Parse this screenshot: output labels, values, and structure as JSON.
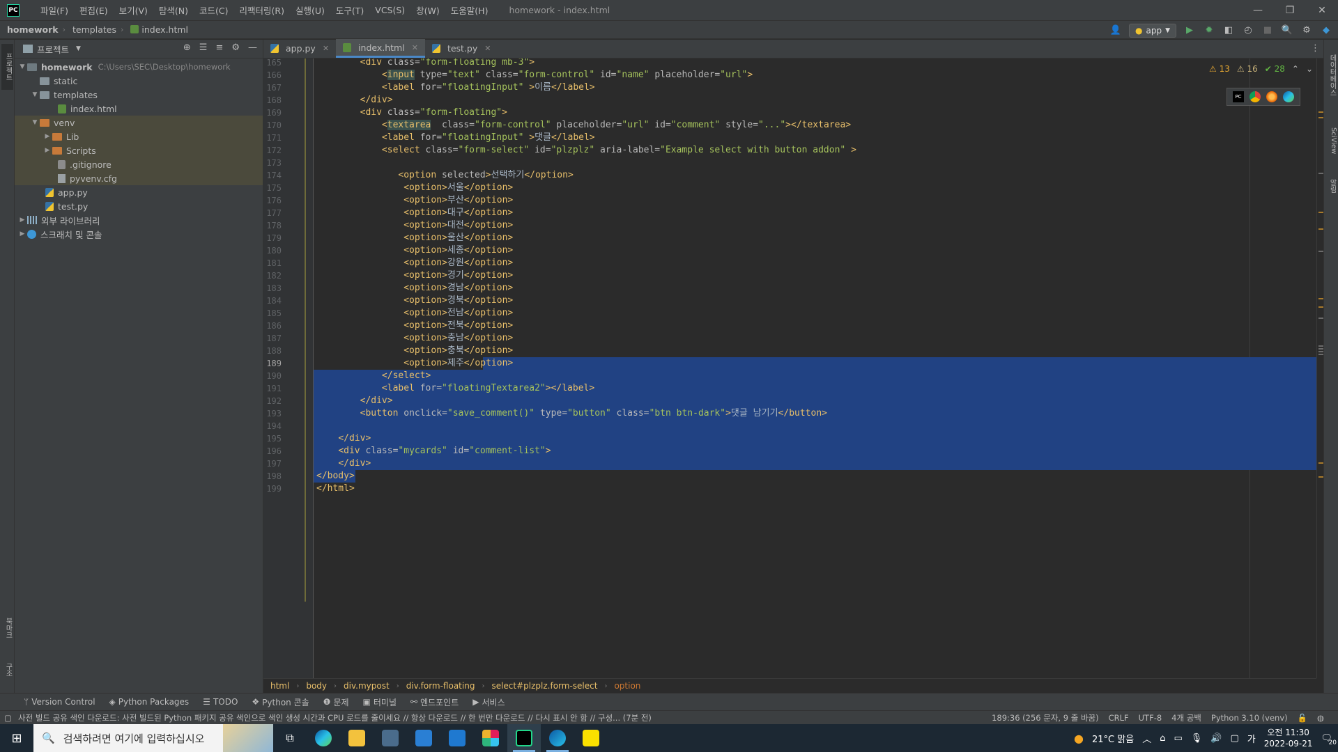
{
  "titlebar": {
    "menus": [
      "파일(F)",
      "편집(E)",
      "보기(V)",
      "탐색(N)",
      "코드(C)",
      "리팩터링(R)",
      "실행(U)",
      "도구(T)",
      "VCS(S)",
      "창(W)",
      "도움말(H)"
    ],
    "window_title": "homework - index.html",
    "logo": "PC"
  },
  "navbar": {
    "crumbs": [
      "homework",
      "templates",
      "index.html"
    ],
    "run_config": "app"
  },
  "project": {
    "title": "프로젝트",
    "root_name": "homework",
    "root_path": "C:\\Users\\SEC\\Desktop\\homework",
    "items": {
      "static": "static",
      "templates": "templates",
      "index_html": "index.html",
      "venv": "venv",
      "lib": "Lib",
      "scripts": "Scripts",
      "gitignore": ".gitignore",
      "pyvenv": "pyvenv.cfg",
      "app_py": "app.py",
      "test_py": "test.py",
      "ext_libs": "외부 라이브러리",
      "scratches": "스크래치 및 콘솔"
    }
  },
  "tabs": [
    "app.py",
    "index.html",
    "test.py"
  ],
  "inspections": {
    "warnings": "13",
    "weak": "16",
    "ok": "28"
  },
  "editor": {
    "lines": [
      {
        "n": "165",
        "html": "        <span class='t-tag'>&lt;div </span><span class='t-attr'>class=</span><span class='t-val'>\"form-floating mb-3\"</span><span class='t-tag'>&gt;</span>"
      },
      {
        "n": "166",
        "html": "            <span class='t-tag'>&lt;<span class='t-hl'>input</span> </span><span class='t-attr'>type=</span><span class='t-val'>\"text\"</span> <span class='t-attr'>class=</span><span class='t-val'>\"form-control\"</span> <span class='t-attr'>id=</span><span class='t-val'>\"name\"</span> <span class='t-attr'>placeholder=</span><span class='t-val'>\"url\"</span><span class='t-tag'>&gt;</span>"
      },
      {
        "n": "167",
        "html": "            <span class='t-tag'>&lt;label </span><span class='t-attr'>for=</span><span class='t-val'>\"floatingInput\"</span> <span class='t-tag'>&gt;</span><span class='t-txt'>이름</span><span class='t-tag'>&lt;/label&gt;</span>"
      },
      {
        "n": "168",
        "html": "        <span class='t-tag'>&lt;/div&gt;</span>"
      },
      {
        "n": "169",
        "html": "        <span class='t-tag'>&lt;div </span><span class='t-attr'>class=</span><span class='t-val'>\"form-floating\"</span><span class='t-tag'>&gt;</span>"
      },
      {
        "n": "170",
        "html": "            <span class='t-tag'>&lt;<span class='t-hl'>textarea</span>  </span><span class='t-attr'>class=</span><span class='t-val'>\"form-control\"</span> <span class='t-attr'>placeholder=</span><span class='t-val'>\"url\"</span> <span class='t-attr'>id=</span><span class='t-val'>\"comment\"</span> <span class='t-attr'>style=</span><span class='t-val'>\"...\"</span><span class='t-tag'>&gt;&lt;/textarea&gt;</span>"
      },
      {
        "n": "171",
        "html": "            <span class='t-tag'>&lt;label </span><span class='t-attr'>for=</span><span class='t-val'>\"floatingInput\"</span> <span class='t-tag'>&gt;</span><span class='t-txt'>댓글</span><span class='t-tag'>&lt;/label&gt;</span>"
      },
      {
        "n": "172",
        "html": "            <span class='t-tag'>&lt;select </span><span class='t-attr'>class=</span><span class='t-val'>\"form-select\"</span> <span class='t-attr'>id=</span><span class='t-val'>\"plzplz\"</span> <span class='t-attr'>aria-label=</span><span class='t-val'>\"Example select with button addon\"</span> <span class='t-tag'>&gt;</span>"
      },
      {
        "n": "173",
        "html": ""
      },
      {
        "n": "174",
        "html": "               <span class='t-tag'>&lt;option </span><span class='t-attr'>selected</span><span class='t-tag'>&gt;</span><span class='t-txt'>선택하기</span><span class='t-tag'>&lt;/option&gt;</span>"
      },
      {
        "n": "175",
        "html": "                <span class='t-tag'>&lt;option&gt;</span><span class='t-txt'>서울</span><span class='t-tag'>&lt;/option&gt;</span>"
      },
      {
        "n": "176",
        "html": "                <span class='t-tag'>&lt;option&gt;</span><span class='t-txt'>부산</span><span class='t-tag'>&lt;/option&gt;</span>"
      },
      {
        "n": "177",
        "html": "                <span class='t-tag'>&lt;option&gt;</span><span class='t-txt'>대구</span><span class='t-tag'>&lt;/option&gt;</span>"
      },
      {
        "n": "178",
        "html": "                <span class='t-tag'>&lt;option&gt;</span><span class='t-txt'>대전</span><span class='t-tag'>&lt;/option&gt;</span>"
      },
      {
        "n": "179",
        "html": "                <span class='t-tag'>&lt;option&gt;</span><span class='t-txt'>울산</span><span class='t-tag'>&lt;/option&gt;</span>"
      },
      {
        "n": "180",
        "html": "                <span class='t-tag'>&lt;option&gt;</span><span class='t-txt'>세종</span><span class='t-tag'>&lt;/option&gt;</span>"
      },
      {
        "n": "181",
        "html": "                <span class='t-tag'>&lt;option&gt;</span><span class='t-txt'>강원</span><span class='t-tag'>&lt;/option&gt;</span>"
      },
      {
        "n": "182",
        "html": "                <span class='t-tag'>&lt;option&gt;</span><span class='t-txt'>경기</span><span class='t-tag'>&lt;/option&gt;</span>"
      },
      {
        "n": "183",
        "html": "                <span class='t-tag'>&lt;option&gt;</span><span class='t-txt'>경남</span><span class='t-tag'>&lt;/option&gt;</span>"
      },
      {
        "n": "184",
        "html": "                <span class='t-tag'>&lt;option&gt;</span><span class='t-txt'>경북</span><span class='t-tag'>&lt;/option&gt;</span>"
      },
      {
        "n": "185",
        "html": "                <span class='t-tag'>&lt;option&gt;</span><span class='t-txt'>전남</span><span class='t-tag'>&lt;/option&gt;</span>"
      },
      {
        "n": "186",
        "html": "                <span class='t-tag'>&lt;option&gt;</span><span class='t-txt'>전북</span><span class='t-tag'>&lt;/option&gt;</span>"
      },
      {
        "n": "187",
        "html": "                <span class='t-tag'>&lt;option&gt;</span><span class='t-txt'>충남</span><span class='t-tag'>&lt;/option&gt;</span>"
      },
      {
        "n": "188",
        "html": "                <span class='t-tag'>&lt;option&gt;</span><span class='t-txt'>충북</span><span class='t-tag'>&lt;/option&gt;</span>"
      },
      {
        "n": "189",
        "html": "                <span class='t-tag'>&lt;option&gt;</span><span class='t-txt'>제주</span><span class='t-tag'>&lt;/option&gt;</span>"
      },
      {
        "n": "190",
        "html": "            <span class='t-tag'>&lt;/select&gt;</span>"
      },
      {
        "n": "191",
        "html": "            <span class='t-tag'>&lt;label </span><span class='t-attr'>for=</span><span class='t-val'>\"floatingTextarea2\"</span><span class='t-tag'>&gt;&lt;/label&gt;</span>"
      },
      {
        "n": "192",
        "html": "        <span class='t-tag'>&lt;/div&gt;</span>"
      },
      {
        "n": "193",
        "html": "        <span class='t-tag'>&lt;button </span><span class='t-attr'>onclick=</span><span class='t-val'>\"save_comment()\"</span> <span class='t-attr'>type=</span><span class='t-val'>\"button\"</span> <span class='t-attr'>class=</span><span class='t-val'>\"btn btn-dark\"</span><span class='t-tag'>&gt;</span><span class='t-txt'>댓글 남기기</span><span class='t-tag'>&lt;/button&gt;</span>"
      },
      {
        "n": "194",
        "html": ""
      },
      {
        "n": "195",
        "html": "    <span class='t-tag'>&lt;/div&gt;</span>"
      },
      {
        "n": "196",
        "html": "    <span class='t-tag'>&lt;div </span><span class='t-attr'>class=</span><span class='t-val'>\"mycards\"</span> <span class='t-attr'>id=</span><span class='t-val'>\"comment-list\"</span><span class='t-tag'>&gt;</span>"
      },
      {
        "n": "197",
        "html": "    <span class='t-tag'>&lt;/div&gt;</span>"
      },
      {
        "n": "198",
        "html": "<span class='t-tag'>&lt;/body&gt;</span>"
      },
      {
        "n": "199",
        "html": "<span class='t-tag'>&lt;/html&gt;</span>"
      }
    ],
    "cursor_line": "189"
  },
  "editor_crumbs": [
    "html",
    "body",
    "div.mypost",
    "div.form-floating",
    "select#plzplz.form-select",
    "option"
  ],
  "tool_windows": [
    "Version Control",
    "Python Packages",
    "TODO",
    "Python 콘솔",
    "문제",
    "터미널",
    "엔드포인트",
    "서비스"
  ],
  "status": {
    "message": "사전 빌드 공유 색인 다운로드: 사전 빌드된 Python 패키지 공유 색인으로 색인 생성 시간과 CPU 로드를 줄이세요 // 항상 다운로드 // 한 번만 다운로드 // 다시 표시 안 함 // 구성... (7분 전)",
    "position": "189:36 (256 문자, 9 줄 바꿈)",
    "line_sep": "CRLF",
    "encoding": "UTF-8",
    "indent": "4개 공백",
    "interpreter": "Python 3.10 (venv)"
  },
  "taskbar": {
    "search_placeholder": "검색하려면 여기에 입력하십시오",
    "weather": "21°C 맑음",
    "ime": "가",
    "time": "오전 11:30",
    "date": "2022-09-21",
    "notif_count": "20"
  },
  "left_stripe": {
    "project": "프로젝트",
    "bookmarks": "북마크",
    "structure": "구조"
  },
  "right_stripe": {
    "database": "데이터베이스",
    "sciview": "SciView",
    "notifications": "알림"
  }
}
